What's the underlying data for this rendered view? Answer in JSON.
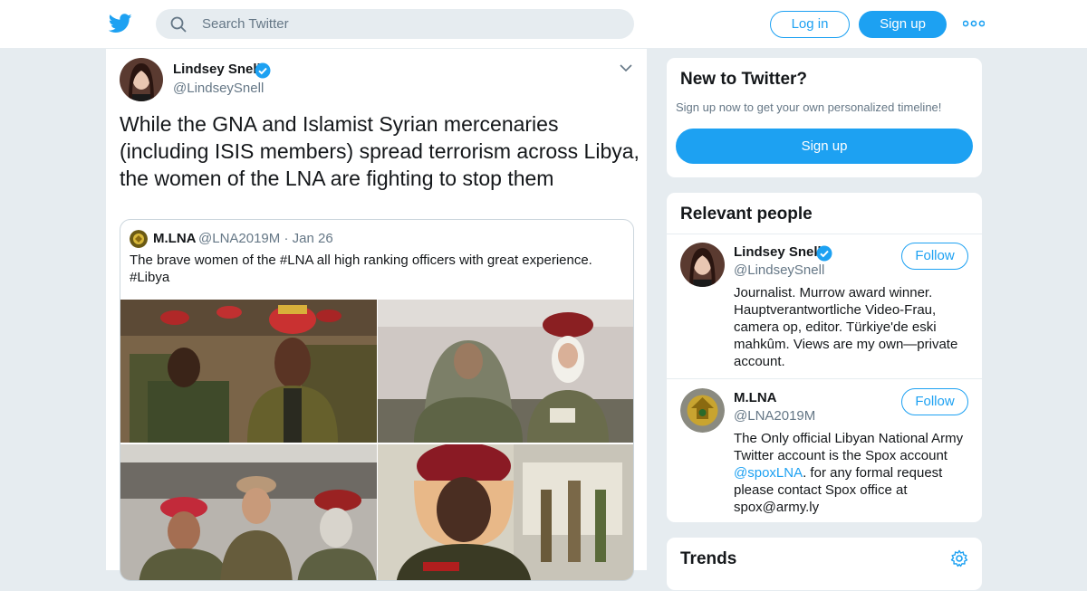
{
  "header": {
    "search_placeholder": "Search Twitter",
    "login_label": "Log in",
    "signup_label": "Sign up",
    "brand_color": "#1da1f2"
  },
  "tweet": {
    "author_name": "Lindsey Snell",
    "author_handle": "@LindseySnell",
    "text": "While the GNA and Islamist Syrian mercenaries (including ISIS members) spread terrorism across Libya, the women of the LNA are fighting to stop them",
    "quote": {
      "author_name": "M.LNA",
      "author_handle": "@LNA2019M",
      "separator": "·",
      "date": "Jan 26",
      "text": "The brave women of the #LNA all high ranking officers with great experience. #Libya"
    }
  },
  "sidebar": {
    "new_to_twitter": {
      "title": "New to Twitter?",
      "subtitle": "Sign up now to get your own personalized timeline!",
      "button": "Sign up"
    },
    "relevant_people": {
      "title": "Relevant people",
      "people": [
        {
          "name": "Lindsey Snell",
          "handle": "@LindseySnell",
          "follow": "Follow",
          "bio": "Journalist. Murrow award winner. Hauptverantwortliche Video-Frau, camera op, editor. Türkiye'de eski mahkûm. Views are my own—private account."
        },
        {
          "name": "M.LNA",
          "handle": "@LNA2019M",
          "follow": "Follow",
          "bio_part1": "The Only official Libyan National Army Twitter account is the Spox account ",
          "bio_link": "@spoxLNA",
          "bio_part2": ". for any formal request please contact Spox office at spox@army.ly"
        }
      ]
    },
    "trends": {
      "title": "Trends"
    }
  }
}
